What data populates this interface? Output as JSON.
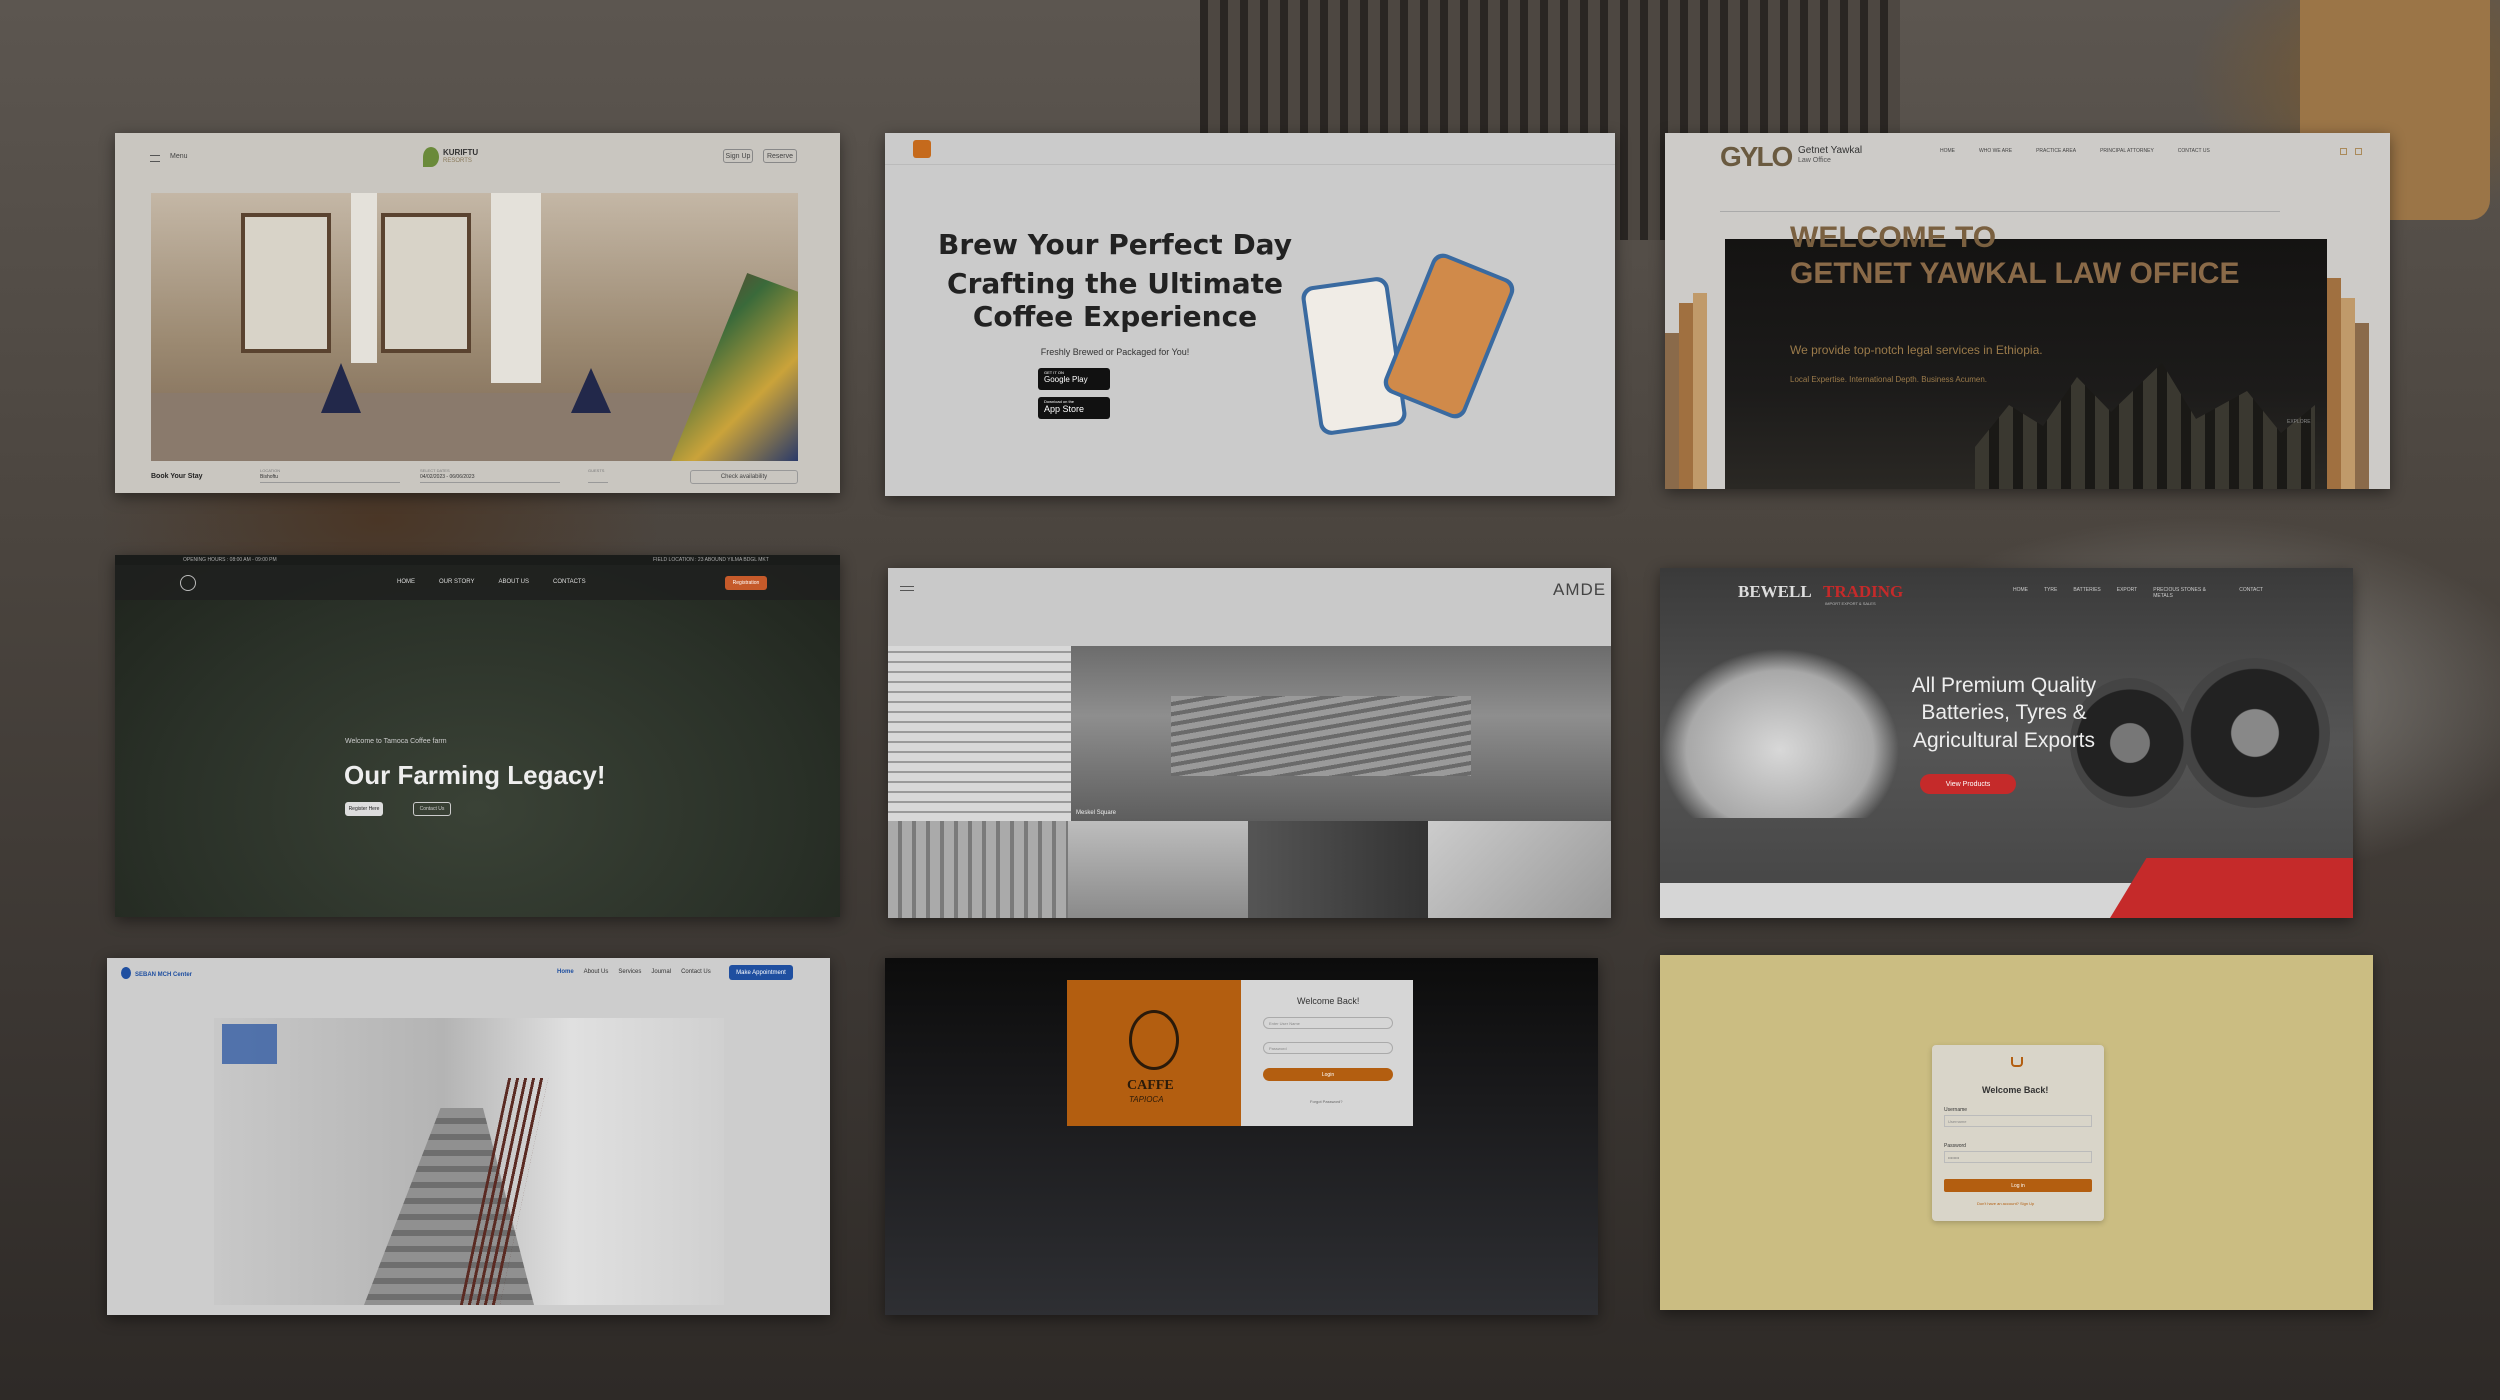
{
  "card1": {
    "menu": "Menu",
    "brand": "KURIFTU",
    "brand_sub": "RESORTS",
    "sign_up": "Sign Up",
    "reserve": "Reserve",
    "book": "Book Your Stay",
    "location_label": "LOCATION",
    "location_value": "Bishoftu",
    "dates_label": "SELECT DATES",
    "dates_value": "04/02/2023 - 06/06/2023",
    "guests_label": "GUESTS",
    "check": "Check availability"
  },
  "card2": {
    "title1": "Brew Your Perfect Day",
    "title2": "Crafting the Ultimate",
    "title3": "Coffee Experience",
    "tagline": "Freshly Brewed or Packaged for You!",
    "google": "Google Play",
    "google_pre": "GET IT ON",
    "apple": "App Store",
    "apple_pre": "Download on the"
  },
  "card3": {
    "logo": "GYLO",
    "firm": "Getnet Yawkal",
    "firm_sub": "Law Office",
    "nav": [
      "HOME",
      "WHO WE ARE",
      "PRACTICE AREA",
      "PRINCIPAL ATTORNEY",
      "CONTACT US"
    ],
    "welcome": "WELCOME TO",
    "name": "GETNET YAWKAL LAW OFFICE",
    "desc": "We provide top-notch legal services in Ethiopia.",
    "tags": "Local Expertise. International Depth. Business Acumen.",
    "explore": "EXPLORE"
  },
  "card4": {
    "hours": "OPENING HOURS : 08:00 AM - 09:00 PM",
    "location": "FIELD LOCATION : 23 ABOUND YILMA BDGL MKT",
    "nav": [
      "HOME",
      "OUR STORY",
      "ABOUT US",
      "CONTACTS"
    ],
    "register": "Registration",
    "kicker": "Welcome to Tamoca Coffee farm",
    "title": "Our Farming Legacy!",
    "btn1": "Register Here",
    "btn2": "Contact Us"
  },
  "card5": {
    "brand": "AMDE",
    "caption": "Meskel Square"
  },
  "card6": {
    "brand1": "BEWELL",
    "brand2": "TRADING",
    "sub": "IMPORT EXPORT & SALES",
    "nav": [
      "HOME",
      "TYRE",
      "BATTERIES",
      "EXPORT",
      "PRECIOUS STONES & METALS",
      "CONTACT"
    ],
    "headline": "All Premium Quality Batteries, Tyres & Agricultural Exports",
    "cta": "View Products"
  },
  "card7": {
    "org": "SEBAN MCH Center",
    "nav": [
      "Home",
      "About Us",
      "Services",
      "Journal",
      "Contact Us"
    ],
    "cta": "Make Appointment"
  },
  "card8": {
    "title": "Welcome Back!",
    "email_ph": "Enter User Name",
    "pass_ph": "Password",
    "login": "Login",
    "forgot": "Forgot Password?",
    "brand": "CAFFE",
    "brand_sub": "TAPIOCA"
  },
  "card9": {
    "title": "Welcome Back!",
    "user_label": "Username",
    "user_ph": "Username",
    "pass_label": "Password",
    "pass_ph": "••••••••",
    "login": "Log in",
    "signup": "Don't have an account? Sign Up"
  },
  "colors": {
    "accent_orange": "#c56a1c",
    "law_gold": "#9c7a4a",
    "bewell_red": "#c52a2a",
    "blue": "#1f4fa0"
  }
}
